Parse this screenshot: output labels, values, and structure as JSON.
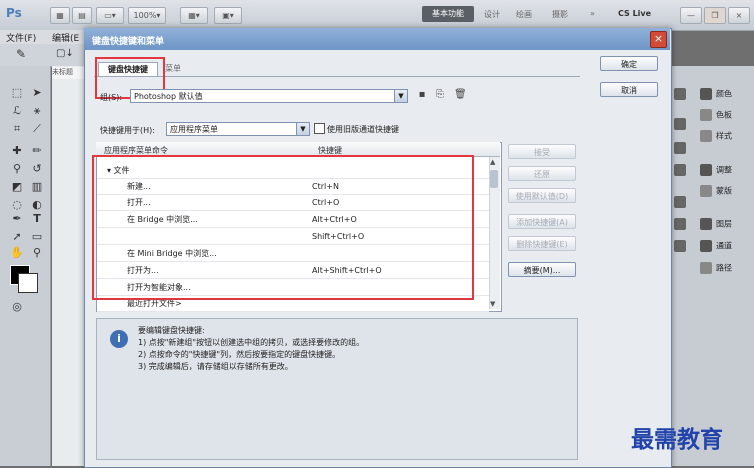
{
  "app": {
    "logo": "Ps",
    "workspace_active": "基本功能",
    "workspaces": [
      "设计",
      "绘画",
      "摄影"
    ],
    "more": "»",
    "cslive": "CS Live",
    "menus": [
      "文件(F)",
      "编辑(E"
    ],
    "zoom": "100%"
  },
  "document": {
    "tab": "未标题"
  },
  "dialog": {
    "title": "键盘快捷键和菜单",
    "close_label": "×",
    "tabs": {
      "shortcuts": "键盘快捷键",
      "menus": "菜单"
    },
    "set_label": "组(S):",
    "set_value": "Photoshop 默认值",
    "shortcuts_for_label": "快捷键用于(H):",
    "shortcuts_for_value": "应用程序菜单",
    "legacy_checkbox_label": "使用旧版通道快捷键",
    "table": {
      "col_command": "应用程序菜单命令",
      "col_shortcut": "快捷键",
      "rows": [
        {
          "command": "▾ 文件",
          "shortcut": ""
        },
        {
          "command": "新建...",
          "shortcut": "Ctrl+N"
        },
        {
          "command": "打开...",
          "shortcut": "Ctrl+O"
        },
        {
          "command": "在 Bridge 中浏览...",
          "shortcut": "Alt+Ctrl+O"
        },
        {
          "command": "",
          "shortcut": "Shift+Ctrl+O"
        },
        {
          "command": "在 Mini Bridge 中浏览...",
          "shortcut": ""
        },
        {
          "command": "打开为...",
          "shortcut": "Alt+Shift+Ctrl+O"
        },
        {
          "command": "打开为智能对象...",
          "shortcut": ""
        },
        {
          "command": "最近打开文件>",
          "shortcut": ""
        }
      ]
    },
    "buttons": {
      "ok": "确定",
      "cancel": "取消",
      "accept": "接受",
      "undo": "还原",
      "use_default": "使用默认值(D)",
      "add_shortcut": "添加快捷键(A)",
      "delete_shortcut": "删除快捷键(E)",
      "summarize": "摘要(M)..."
    },
    "info": {
      "line1": "要编辑键盘快捷键:",
      "line2": "1) 点按\"新建组\"按钮以创建选中组的拷贝，或选择要修改的组。",
      "line3": "2) 点按命令的\"快捷键\"列，然后按要指定的键盘快捷键。",
      "line4": "3) 完成编辑后，请存储组以存储所有更改。"
    }
  },
  "panels": {
    "items": [
      "颜色",
      "色板",
      "样式",
      "调整",
      "蒙版",
      "图层",
      "通道",
      "路径"
    ]
  },
  "watermark": "最需教育"
}
